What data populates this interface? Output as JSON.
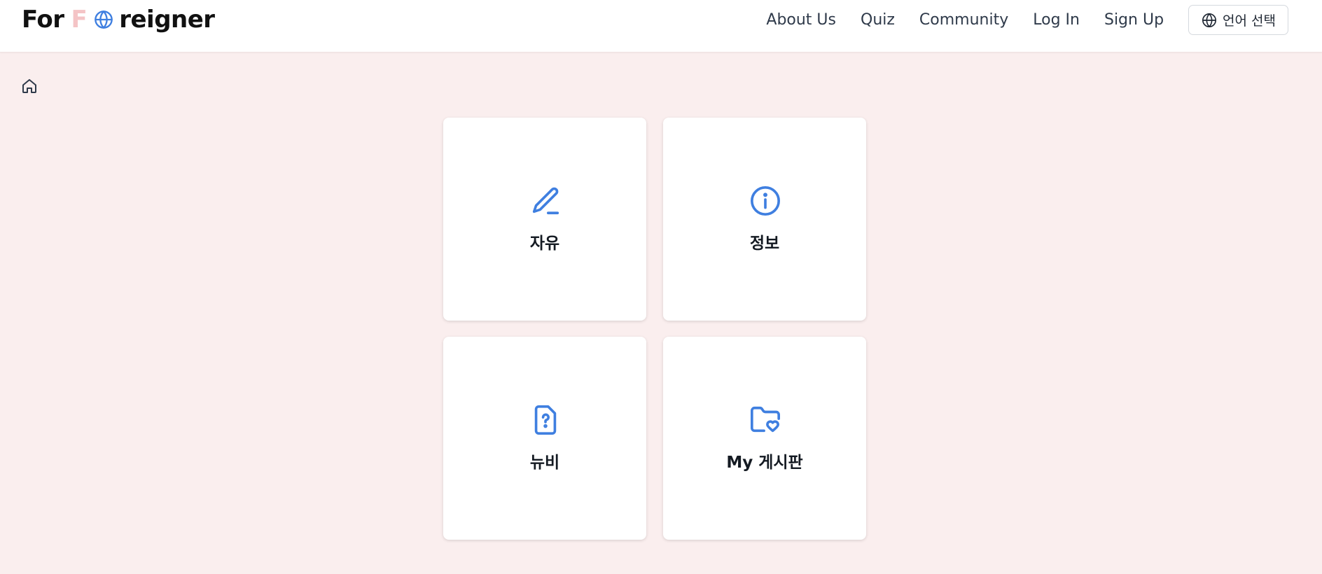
{
  "header": {
    "logo": {
      "part1": "For",
      "part2": "F",
      "part3": "reigner"
    },
    "nav": {
      "about": "About Us",
      "quiz": "Quiz",
      "community": "Community",
      "login": "Log In",
      "signup": "Sign Up"
    },
    "language_button": "언어 선택"
  },
  "icons": {
    "home": "home-icon",
    "globe": "globe-icon",
    "pencil": "pencil-icon",
    "info": "info-icon",
    "question_file": "file-question-icon",
    "folder_heart": "folder-heart-icon"
  },
  "boards": [
    {
      "label": "자유",
      "icon": "pencil-icon"
    },
    {
      "label": "정보",
      "icon": "info-icon"
    },
    {
      "label": "뉴비",
      "icon": "file-question-icon"
    },
    {
      "label": "My 게시판",
      "icon": "folder-heart-icon"
    }
  ],
  "colors": {
    "background": "#faeeee",
    "accent": "#3f7fe0",
    "logo_faded": "#f4c4c6",
    "text": "#111111"
  }
}
